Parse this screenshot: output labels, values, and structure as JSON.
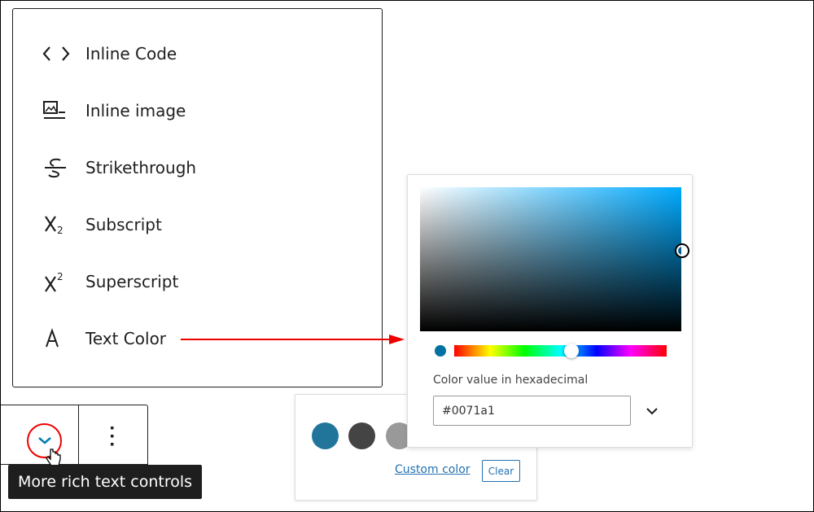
{
  "menu": {
    "items": [
      {
        "label": "Inline Code",
        "icon": "code-icon"
      },
      {
        "label": "Inline image",
        "icon": "image-icon"
      },
      {
        "label": "Strikethrough",
        "icon": "strikethrough-icon"
      },
      {
        "label": "Subscript",
        "icon": "subscript-icon"
      },
      {
        "label": "Superscript",
        "icon": "superscript-icon"
      },
      {
        "label": "Text Color",
        "icon": "text-color-icon"
      }
    ]
  },
  "palette": {
    "swatches": [
      "#21759b",
      "#444444",
      "#999999"
    ],
    "custom_color": "Custom color",
    "clear": "Clear"
  },
  "picker": {
    "hex_label": "Color value in hexadecimal",
    "hex_value": "#0071a1",
    "current_color": "#0071a1",
    "hue_fraction": 0.55
  },
  "toolbar": {
    "tooltip": "More rich text controls"
  },
  "colors": {
    "annotation": "#e00000",
    "accent": "#2271b1"
  }
}
